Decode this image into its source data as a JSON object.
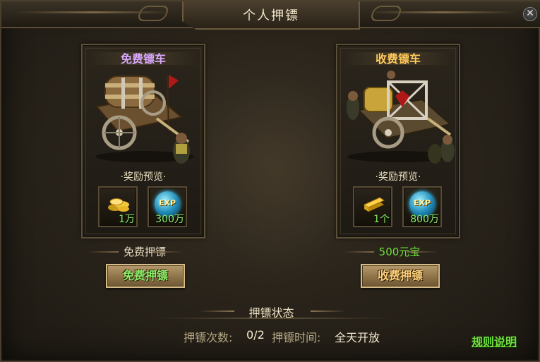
{
  "window": {
    "title": "个人押镖",
    "close_icon": "close-icon"
  },
  "carts": [
    {
      "title": "免费镖车",
      "title_color": "#d9a8ff",
      "reward_label": "·奖励预览·",
      "rewards": [
        {
          "icon": "gold-coins-icon",
          "qty": "1万"
        },
        {
          "icon": "exp-orb-icon",
          "icon_text": "EXP",
          "qty": "300万"
        }
      ],
      "cost_label": "免费押镖",
      "cost_color": "#e8dcc0",
      "button_label": "免费押镖",
      "button_color": "#8df06a"
    },
    {
      "title": "收费镖车",
      "title_color": "#ffc95a",
      "reward_label": "·奖励预览·",
      "rewards": [
        {
          "icon": "gold-ingot-icon",
          "qty": "1个"
        },
        {
          "icon": "exp-orb-icon",
          "icon_text": "EXP",
          "qty": "800万"
        }
      ],
      "cost_label": "500元宝",
      "cost_color": "#6fe03c",
      "button_label": "收费押镖",
      "button_color": "#ffd27a"
    }
  ],
  "status": {
    "title": "押镖状态",
    "count_label": "押镖次数:",
    "count_value": "0/2",
    "time_label": "押镖时间:",
    "time_value": "全天开放"
  },
  "rules_link": "规则说明"
}
